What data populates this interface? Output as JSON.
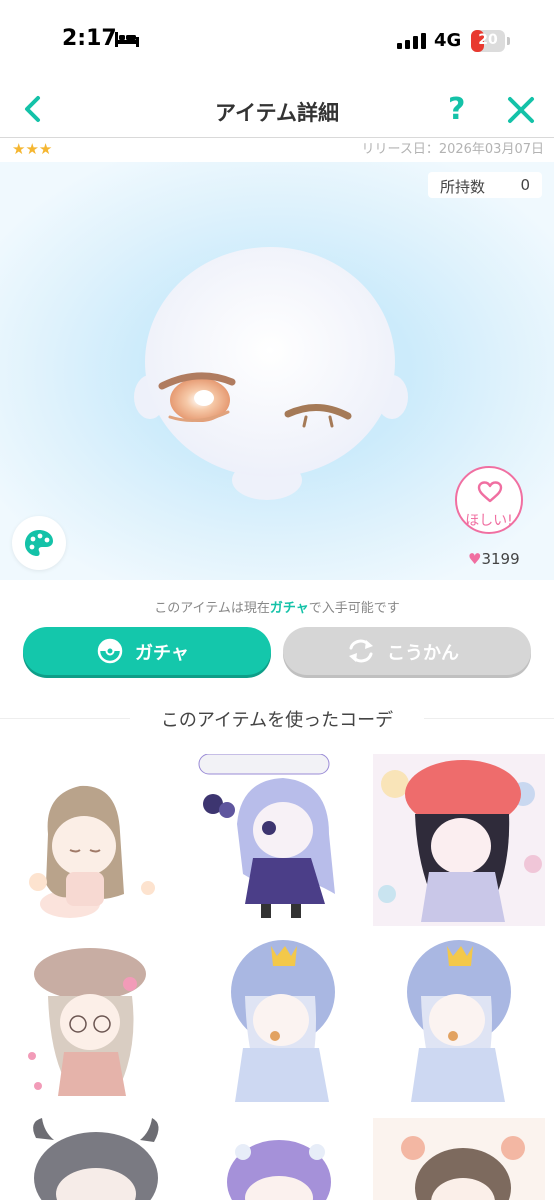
{
  "status_bar": {
    "time": "2:17",
    "network": "4G",
    "battery": "20",
    "battery_level": 0.2
  },
  "header": {
    "title": "アイテム詳細"
  },
  "item": {
    "rarity_stars": "★★★",
    "release_date": "リリース日：2026年03月07日",
    "owned_label": "所持数",
    "owned_count": "0"
  },
  "want": {
    "label": "ほしい!",
    "count": "3199"
  },
  "availability": {
    "prefix": "このアイテムは現在",
    "highlight": "ガチャ",
    "suffix": "で入手可能です"
  },
  "actions": {
    "gacha_label": "ガチャ",
    "trade_label": "こうかん"
  },
  "coords_section": {
    "title": "このアイテムを使ったコーデ"
  },
  "icons": [
    "bed-icon",
    "signal-icon",
    "back-arrow-icon",
    "help-icon",
    "close-icon",
    "palette-icon",
    "heart-icon",
    "gacha-icon",
    "exchange-icon"
  ],
  "colors": {
    "accent": "#14c7ab",
    "pink": "#f06fa1",
    "star": "#f5b631",
    "battery": "#e8392f"
  }
}
